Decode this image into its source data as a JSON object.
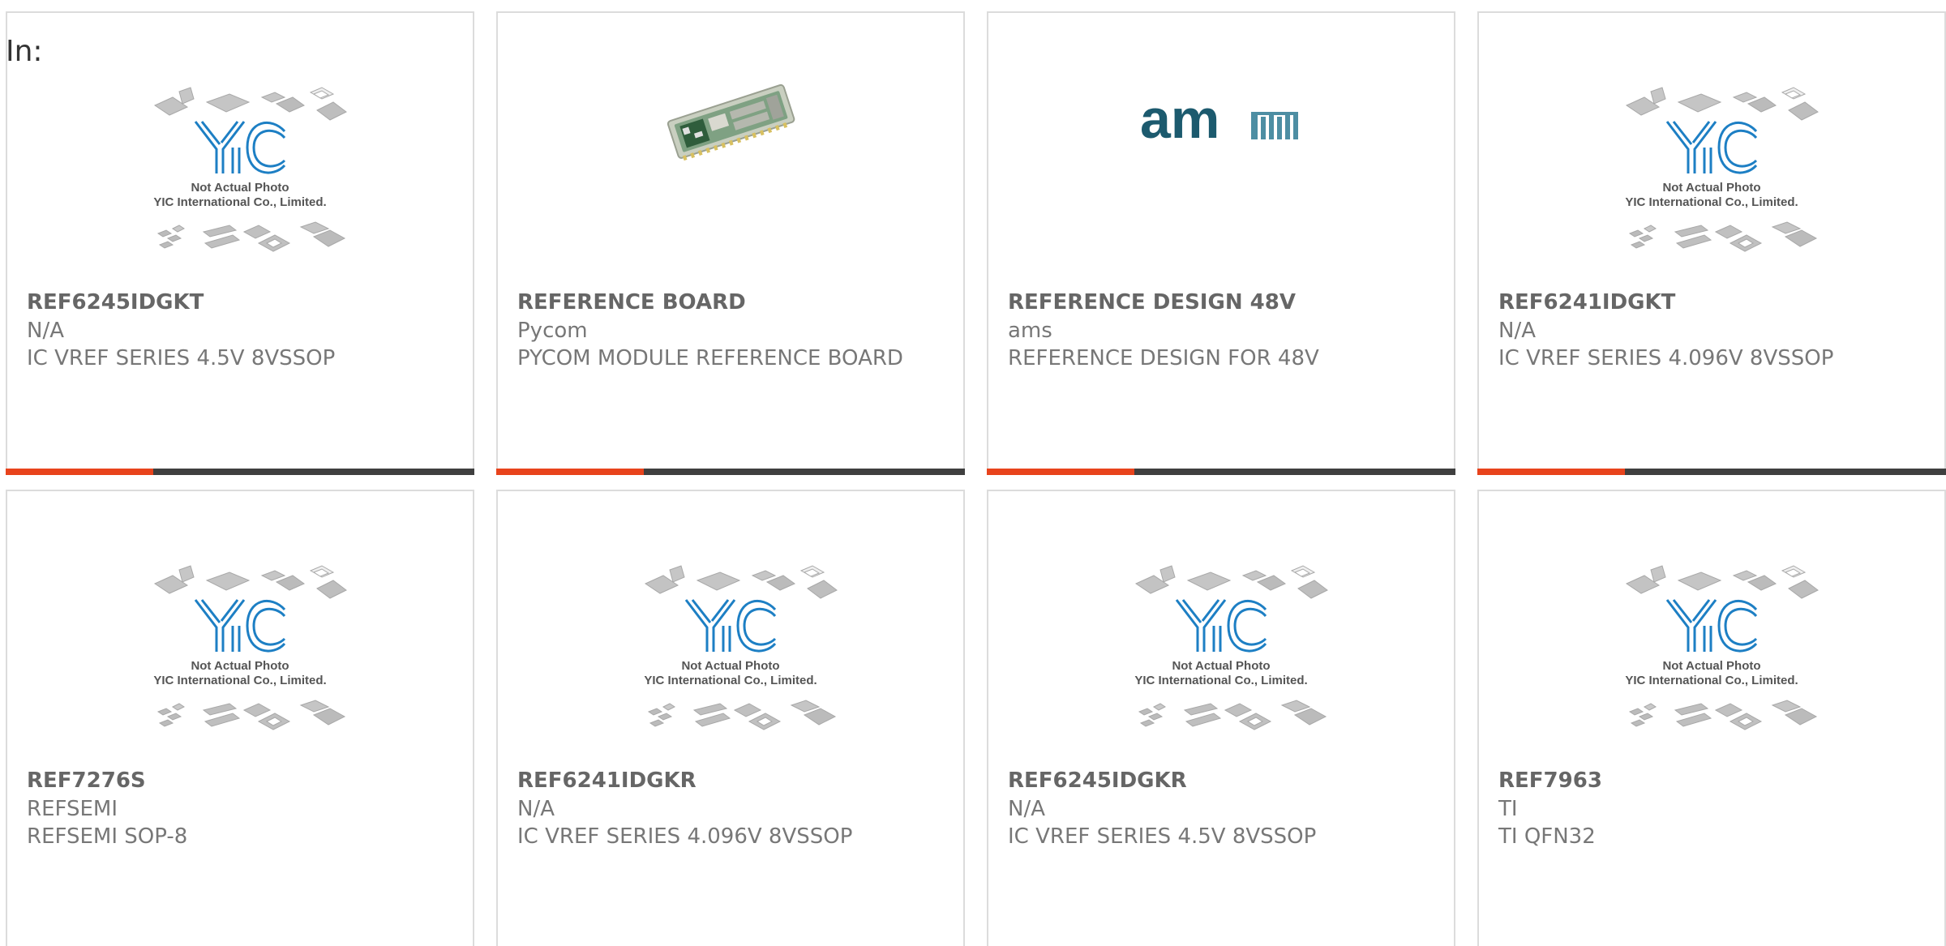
{
  "filter_label": "In:",
  "colors": {
    "accent": "#e8431c",
    "bar": "#3f3f3f",
    "yic_blue": "#1d7fc4",
    "ams_teal": "#1c5a6e"
  },
  "placeholder": {
    "line1": "Not Actual Photo",
    "line2": "YIC International Co., Limited."
  },
  "ams_logo_text": "am",
  "products": [
    {
      "part": "REF6245IDGKT",
      "brand": "N/A",
      "desc": "IC VREF SERIES 4.5V 8VSSOP",
      "image": "placeholder"
    },
    {
      "part": "REFERENCE BOARD",
      "brand": "Pycom",
      "desc": "PYCOM MODULE REFERENCE BOARD",
      "image": "pycom-board"
    },
    {
      "part": "REFERENCE DESIGN 48V",
      "brand": "ams",
      "desc": "REFERENCE DESIGN FOR 48V",
      "image": "ams-logo"
    },
    {
      "part": "REF6241IDGKT",
      "brand": "N/A",
      "desc": "IC VREF SERIES 4.096V 8VSSOP",
      "image": "placeholder"
    },
    {
      "part": "REF7276S",
      "brand": "REFSEMI",
      "desc": "REFSEMI SOP-8",
      "image": "placeholder"
    },
    {
      "part": "REF6241IDGKR",
      "brand": "N/A",
      "desc": "IC VREF SERIES 4.096V 8VSSOP",
      "image": "placeholder"
    },
    {
      "part": "REF6245IDGKR",
      "brand": "N/A",
      "desc": "IC VREF SERIES 4.5V 8VSSOP",
      "image": "placeholder"
    },
    {
      "part": "REF7963",
      "brand": "TI",
      "desc": "TI QFN32",
      "image": "placeholder"
    }
  ]
}
